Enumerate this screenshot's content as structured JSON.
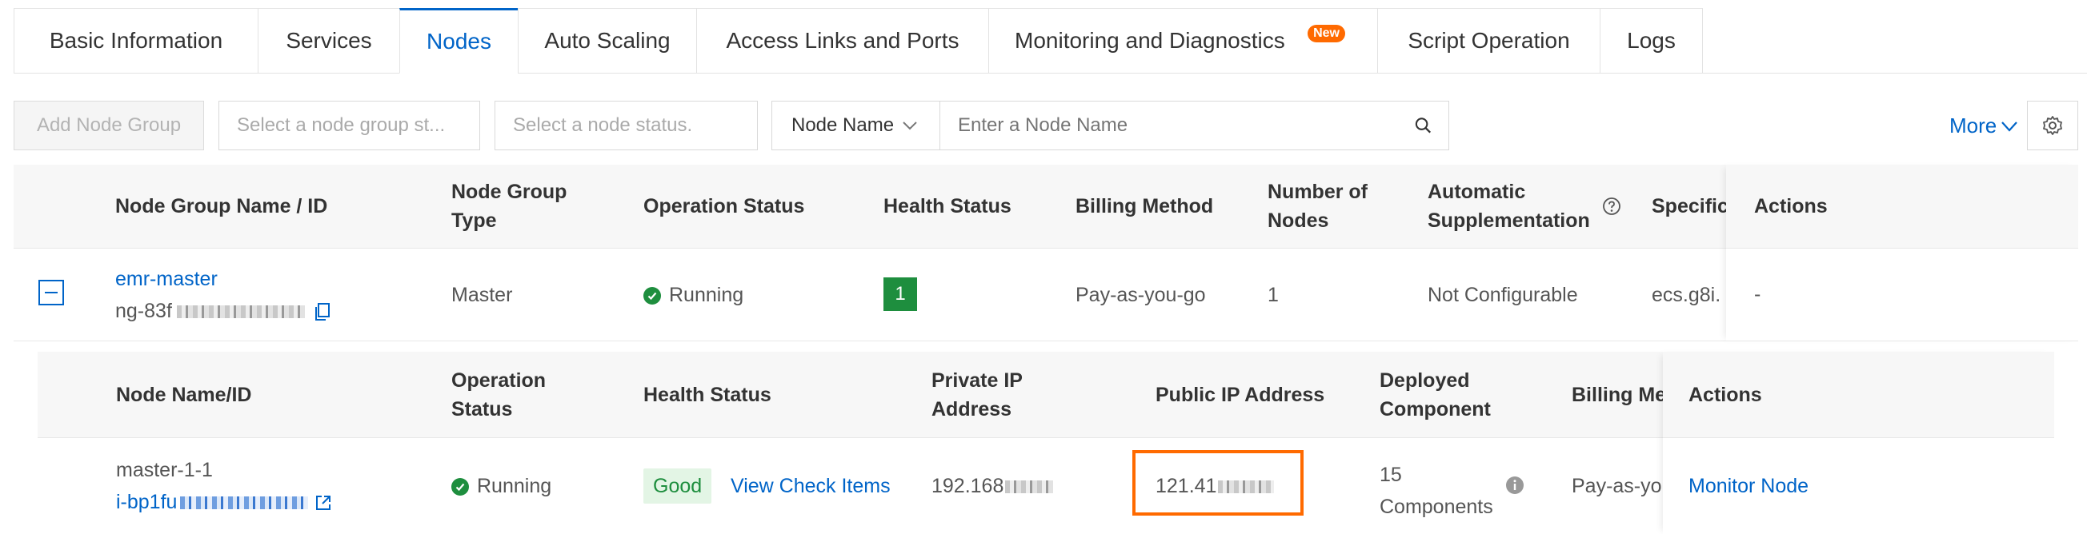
{
  "tabs": [
    {
      "label": "Basic Information",
      "active": false
    },
    {
      "label": "Services",
      "active": false
    },
    {
      "label": "Nodes",
      "active": true
    },
    {
      "label": "Auto Scaling",
      "active": false
    },
    {
      "label": "Access Links and Ports",
      "active": false
    },
    {
      "label": "Monitoring and Diagnostics",
      "active": false,
      "badge": "New"
    },
    {
      "label": "Script Operation",
      "active": false
    },
    {
      "label": "Logs",
      "active": false
    }
  ],
  "toolbar": {
    "add_node_group": "Add Node Group",
    "node_group_status_placeholder": "Select a node group st...",
    "node_status_placeholder": "Select a node status.",
    "search_field": "Node Name",
    "search_placeholder": "Enter a Node Name",
    "more": "More"
  },
  "group_table": {
    "headers": {
      "name": "Node Group Name / ID",
      "type_line1": "Node Group",
      "type_line2": "Type",
      "operation_status": "Operation Status",
      "health_status": "Health Status",
      "billing": "Billing Method",
      "count_line1": "Number of",
      "count_line2": "Nodes",
      "auto_line1": "Automatic",
      "auto_line2": "Supplementation",
      "spec": "Specific",
      "actions": "Actions"
    },
    "row": {
      "name": "emr-master",
      "id": "ng-83f",
      "type": "Master",
      "status": "Running",
      "health": "1",
      "billing": "Pay-as-you-go",
      "count": "1",
      "auto": "Not Configurable",
      "spec": "ecs.g8i.",
      "actions": "-"
    }
  },
  "node_table": {
    "headers": {
      "name": "Node Name/ID",
      "status_line1": "Operation",
      "status_line2": "Status",
      "health": "Health Status",
      "private_line1": "Private IP",
      "private_line2": "Address",
      "public_ip": "Public IP Address",
      "deployed_line1": "Deployed",
      "deployed_line2": "Component",
      "billing": "Billing Me",
      "actions": "Actions"
    },
    "row": {
      "name": "master-1-1",
      "id": "i-bp1fu",
      "status": "Running",
      "health": "Good",
      "view_check": "View Check Items",
      "private_ip": "192.168",
      "public_ip": "121.41",
      "components_line1": "15",
      "components_line2": "Components",
      "billing": "Pay-as-yo",
      "action": "Monitor Node"
    }
  },
  "colors": {
    "accent": "#0064c8",
    "success": "#1e8e3e",
    "highlight": "#ff6a00"
  }
}
